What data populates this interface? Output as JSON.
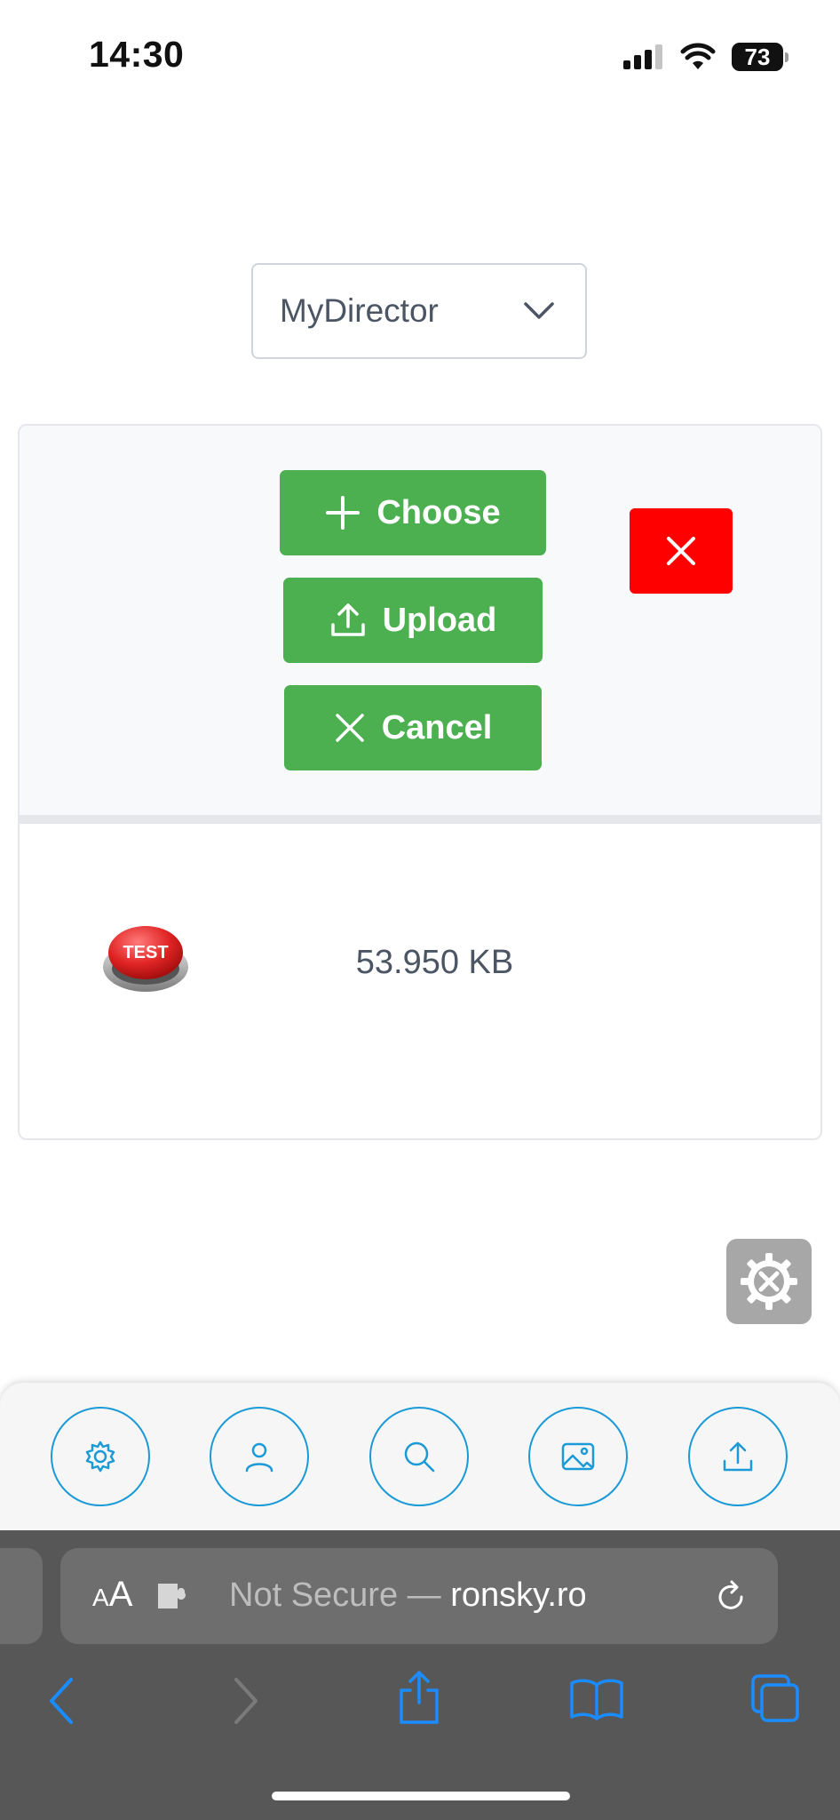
{
  "status_bar": {
    "time": "14:30",
    "battery": "73"
  },
  "selector": {
    "value": "MyDirector"
  },
  "uploader": {
    "choose_label": "Choose",
    "upload_label": "Upload",
    "cancel_label": "Cancel",
    "file": {
      "thumbnail_text": "TEST",
      "size": "53.950 KB"
    }
  },
  "toolbar": {
    "items": [
      "settings-icon",
      "user-icon",
      "search-icon",
      "image-icon",
      "upload-icon"
    ]
  },
  "browser": {
    "aa_label_small": "A",
    "aa_label_large": "A",
    "url_prefix": "Not Secure —",
    "domain": "ronsky.ro"
  },
  "colors": {
    "accent_green": "#4caf50",
    "danger_red": "#ff0000",
    "toolbar_blue": "#1a9ad6",
    "ios_blue": "#1a8cff"
  }
}
